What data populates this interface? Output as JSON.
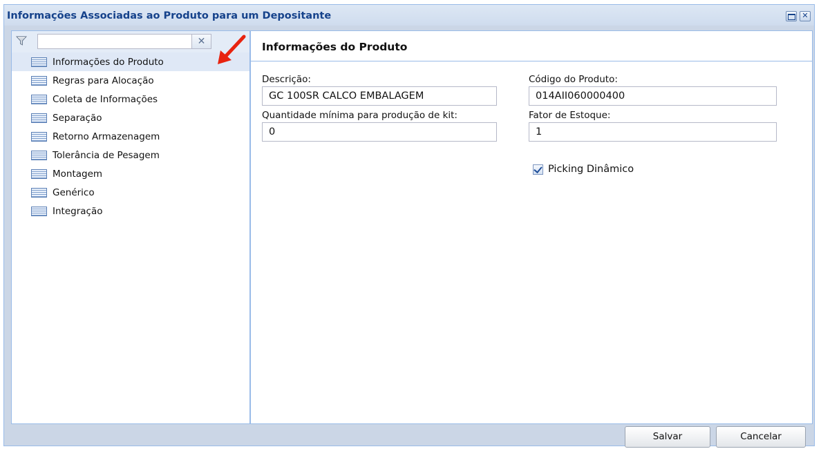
{
  "window": {
    "title": "Informações Associadas ao Produto para um Depositante",
    "maximize_icon": "maximize-icon",
    "close_icon": "close-icon",
    "close_glyph": "✕"
  },
  "sidebar": {
    "filter": {
      "value": "",
      "placeholder": "",
      "icon": "filter-funnel-icon",
      "clear_glyph": "✕"
    },
    "items": [
      {
        "label": "Informações do Produto",
        "selected": true
      },
      {
        "label": "Regras para Alocação"
      },
      {
        "label": "Coleta de Informações"
      },
      {
        "label": "Separação"
      },
      {
        "label": "Retorno Armazenagem"
      },
      {
        "label": "Tolerância de Pesagem"
      },
      {
        "label": "Montagem"
      },
      {
        "label": "Genérico"
      },
      {
        "label": "Integração"
      }
    ],
    "item_icon": "list-icon",
    "annotation_icon": "red-arrow-icon",
    "annotation_color": "#e8230f"
  },
  "main": {
    "title": "Informações do Produto",
    "fields": {
      "descricao": {
        "label": "Descrição:",
        "value": "GC 100SR CALCO EMBALAGEM"
      },
      "codigo": {
        "label": "Código do Produto:",
        "value": "014AII060000400"
      },
      "qtd_minima": {
        "label": "Quantidade mínima para produção de kit:",
        "value": "0"
      },
      "fator_estoque": {
        "label": "Fator de Estoque:",
        "value": "1"
      }
    },
    "picking_dinamico": {
      "label": "Picking Dinâmico",
      "checked": true
    }
  },
  "footer": {
    "save_label": "Salvar",
    "cancel_label": "Cancelar"
  },
  "colors": {
    "title_text": "#15428b",
    "border": "#99bbe8",
    "window_bg": "#cbd6e6",
    "selected_row": "#dfe8f6"
  }
}
